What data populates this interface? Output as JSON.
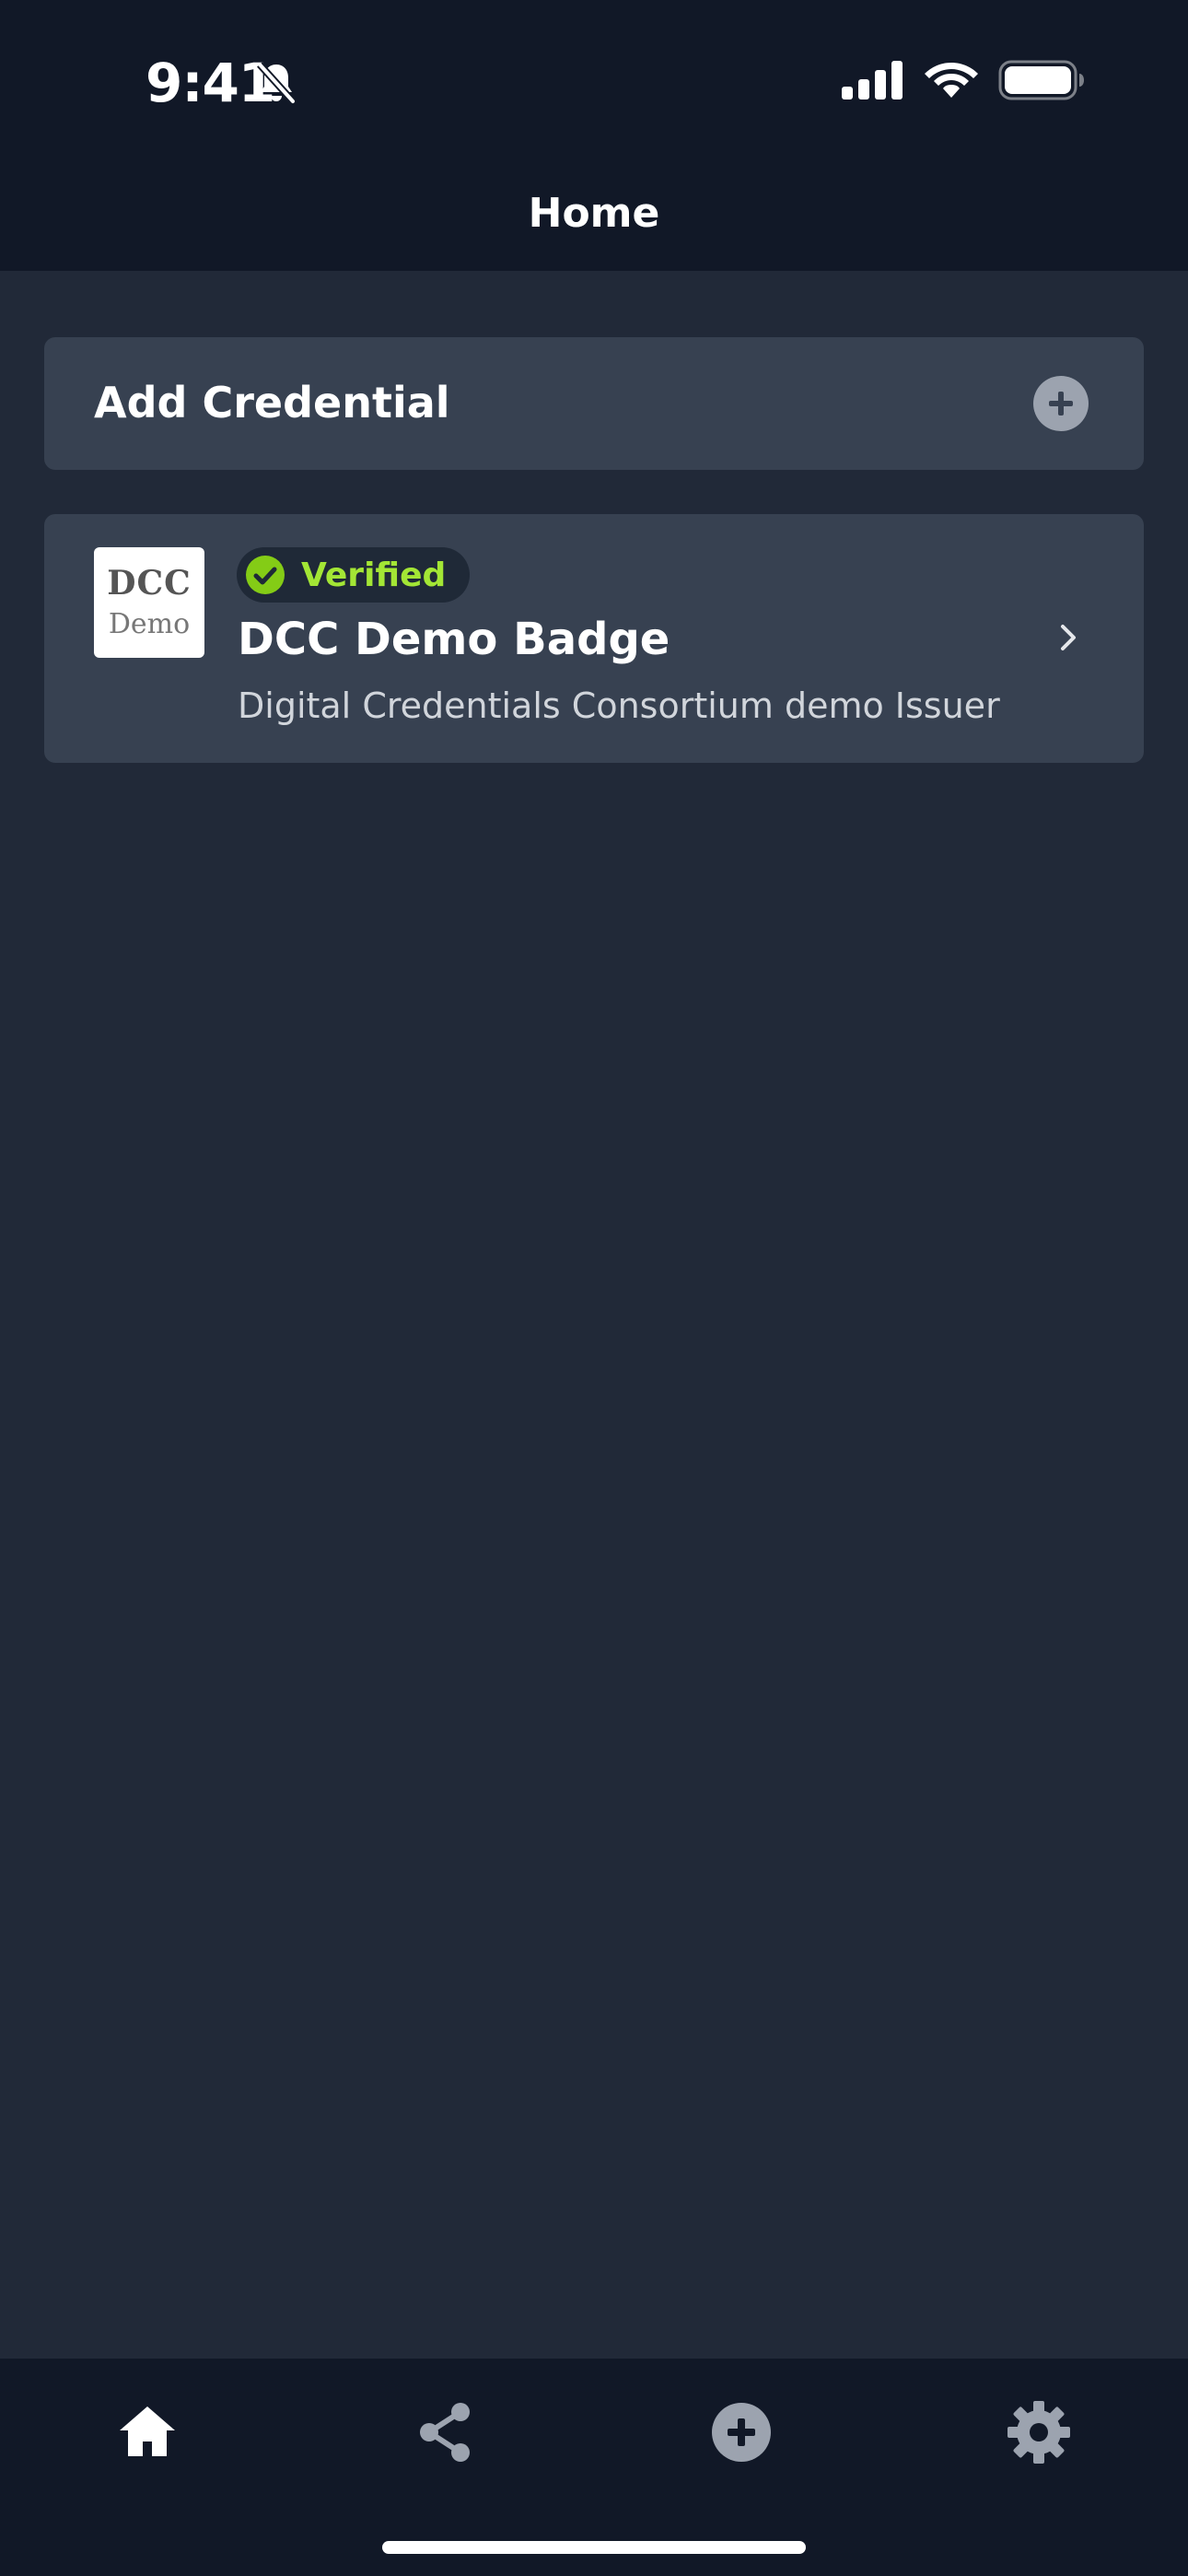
{
  "status_bar": {
    "time": "9:41",
    "icons": [
      "bell-slash-icon",
      "cellular-signal-icon",
      "wifi-icon",
      "battery-icon"
    ]
  },
  "header": {
    "title": "Home"
  },
  "add_credential": {
    "label": "Add Credential",
    "icon": "plus-circle-icon"
  },
  "credentials": [
    {
      "logo_line1": "DCC",
      "logo_line2": "Demo",
      "status": "Verified",
      "title": "DCC Demo Badge",
      "issuer": "Digital Credentials Consortium demo Issuer",
      "chevron": "chevron-right-icon"
    }
  ],
  "tabbar": {
    "items": [
      {
        "icon": "home-icon",
        "active": true
      },
      {
        "icon": "share-icon",
        "active": false
      },
      {
        "icon": "plus-circle-icon",
        "active": false
      },
      {
        "icon": "gear-icon",
        "active": false
      }
    ]
  },
  "colors": {
    "background": "#212938",
    "header": "#111827",
    "card": "#374151",
    "verified_text": "#a3e635",
    "verified_icon": "#84cc16",
    "inactive_icon": "#9ca3af",
    "active_icon": "#ffffff"
  }
}
